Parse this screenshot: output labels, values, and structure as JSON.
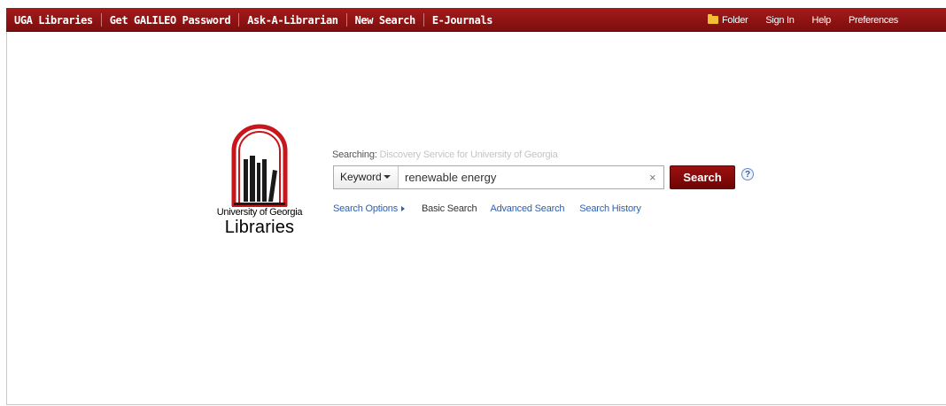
{
  "nav": {
    "links": [
      "UGA Libraries",
      "Get GALILEO Password",
      "Ask-A-Librarian",
      "New Search",
      "E-Journals"
    ],
    "utility": {
      "folder": "Folder",
      "sign_in": "Sign In",
      "help": "Help",
      "preferences": "Preferences"
    }
  },
  "logo": {
    "caption": "University of Georgia",
    "word": "Libraries",
    "colors": {
      "red": "#c8161d",
      "black": "#1a1a1a"
    }
  },
  "search": {
    "searching_label": "Searching:",
    "searching_target": "Discovery Service for University of Georgia",
    "field_select": "Keyword",
    "query": "renewable energy",
    "clear": "×",
    "button": "Search",
    "help": "?"
  },
  "links": {
    "search_options": "Search Options",
    "basic_search": "Basic Search",
    "advanced_search": "Advanced Search",
    "search_history": "Search History"
  },
  "colors": {
    "topbar": "#8f1313",
    "link_blue": "#2e5fae"
  }
}
